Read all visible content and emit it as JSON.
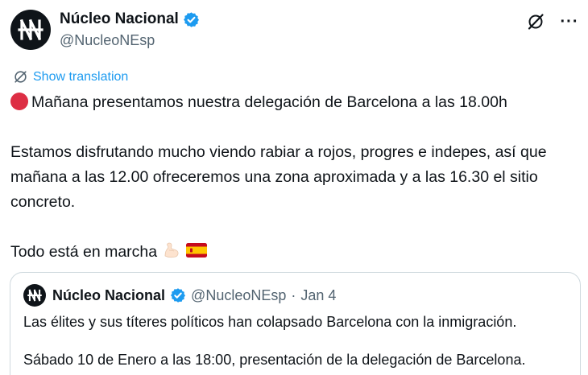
{
  "author": {
    "display_name": "Núcleo Nacional",
    "handle": "@NucleoNEsp",
    "verified": true,
    "avatar_monogram": "NN"
  },
  "actions": {
    "grok_icon": "slashed-circle-icon",
    "more_icon": "more-dots-icon",
    "more_label": "···"
  },
  "translation": {
    "label": "Show translation",
    "icon": "translate-globe-icon"
  },
  "tweet": {
    "line1_emoji": "red-circle-emoji",
    "line1": "Mañana presentamos nuestra delegación de Barcelona a las 18.00h",
    "paragraph2": "Estamos disfrutando mucho viendo rabiar a rojos, progres e indepes, así que mañana a las 12.00 ofreceremos una zona aproximada y a las 16.30 el sitio concreto.",
    "paragraph3": "Todo está en marcha",
    "trailing_emojis": [
      "flexed-biceps-emoji",
      "spain-flag-emoji"
    ]
  },
  "quoted_tweet": {
    "display_name": "Núcleo Nacional",
    "handle": "@NucleoNEsp",
    "separator": "·",
    "date": "Jan 4",
    "verified": true,
    "paragraph1": "Las élites y sus títeres políticos han colapsado Barcelona con la inmigración.",
    "paragraph2": "Sábado 10 de Enero a las 18:00, presentación de la delegación de Barcelona."
  },
  "colors": {
    "text": "#0f1419",
    "secondary": "#536471",
    "link": "#1d9bf0",
    "verified": "#1d9bf0",
    "border": "#cfd9de"
  }
}
